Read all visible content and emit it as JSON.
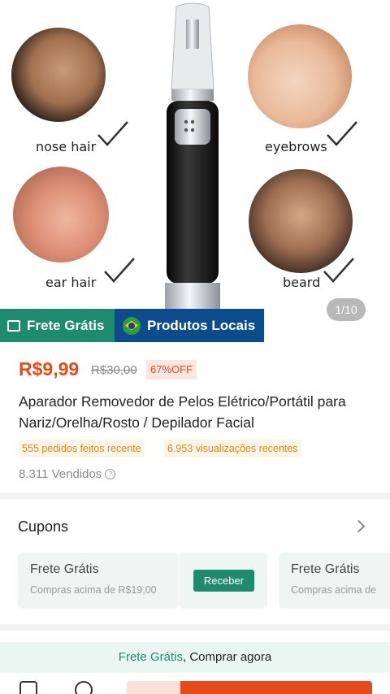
{
  "gallery": {
    "labels": {
      "nose": "nose hair",
      "eyebrows": "eyebrows",
      "ear": "ear hair",
      "beard": "beard"
    },
    "counter": "1/10",
    "tag_free_shipping": "Frete Grátis",
    "tag_local": "Produtos Locais",
    "accent_green": "#1e8a6e",
    "accent_blue": "#0d4c8c"
  },
  "product": {
    "price": "R$9,99",
    "old_price": "R$30,00",
    "discount": "67%OFF",
    "title": "Aparador Removedor de Pelos Elétrico/Portátil para Nariz/Orelha/Rosto / Depilador Facial",
    "orders_chip": "555 pedidos feitos recente",
    "views_chip": "6.953 visualizações recentes",
    "sold": "8.311 Vendidos",
    "price_color": "#e64a19"
  },
  "coupons": {
    "title": "Cupons",
    "items": [
      {
        "title": "Frete Grátis",
        "subtitle": "Compras acima de R$19,00"
      },
      {
        "title": "Frete Grátis",
        "subtitle": "Compras acima de"
      }
    ],
    "receive_label": "Receber"
  },
  "bottom": {
    "banner_highlight": "Frete Grátis",
    "banner_rest": ", Comprar agora"
  }
}
